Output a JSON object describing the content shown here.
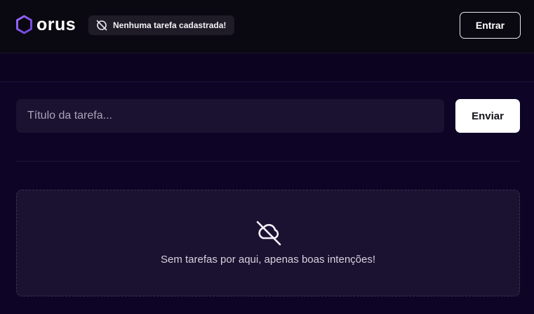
{
  "header": {
    "logo_text": "orus",
    "status_badge": {
      "text": "Nenhuma tarefa cadastrada!",
      "icon": "no-entry-icon"
    },
    "login_label": "Entrar"
  },
  "form": {
    "task_placeholder": "Título da tarefa...",
    "send_label": "Enviar"
  },
  "empty_state": {
    "icon": "cloud-off-icon",
    "message": "Sem tarefas por aqui, apenas boas intenções!"
  },
  "colors": {
    "accent": "#7a4fd9",
    "background": "#0b0320",
    "surface": "#1a1230"
  }
}
